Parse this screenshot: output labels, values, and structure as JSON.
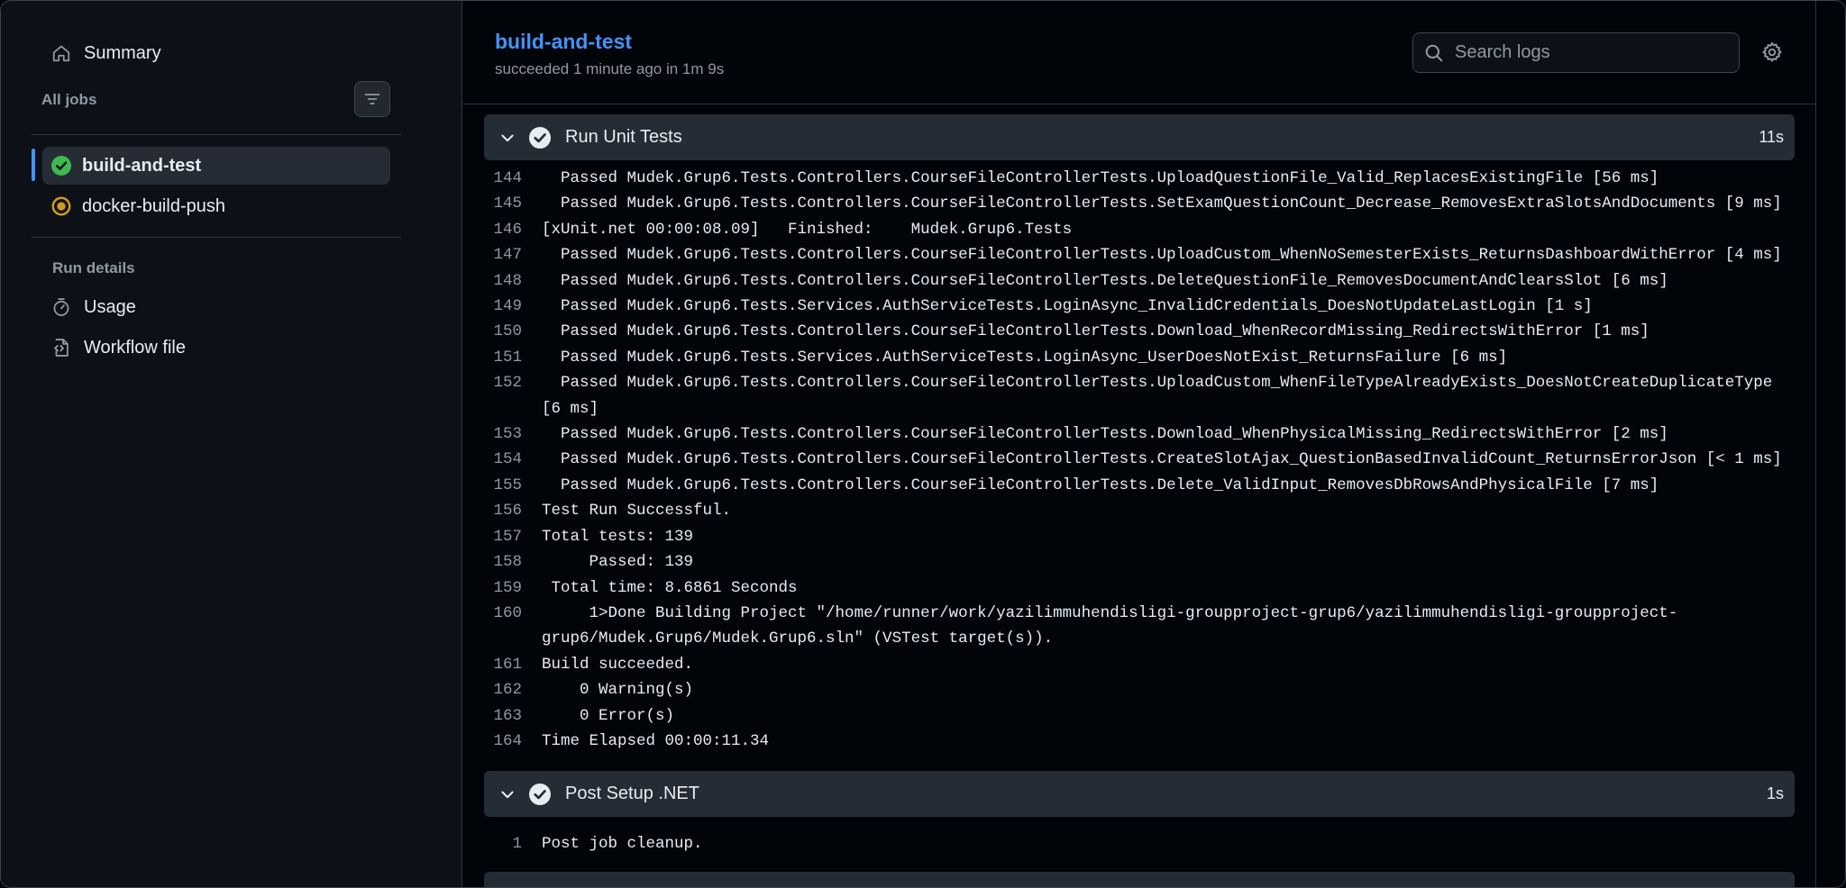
{
  "sidebar": {
    "summary_label": "Summary",
    "all_jobs_label": "All jobs",
    "jobs": [
      {
        "label": "build-and-test",
        "status": "success"
      },
      {
        "label": "docker-build-push",
        "status": "in-progress"
      }
    ],
    "run_details_label": "Run details",
    "usage_label": "Usage",
    "workflow_file_label": "Workflow file"
  },
  "header": {
    "title": "build-and-test",
    "subtitle": "succeeded 1 minute ago in 1m 9s",
    "search_placeholder": "Search logs"
  },
  "steps": [
    {
      "name": "Run Unit Tests",
      "duration": "11s",
      "lines": [
        {
          "n": "144",
          "t": "  Passed Mudek.Grup6.Tests.Controllers.CourseFileControllerTests.UploadQuestionFile_Valid_ReplacesExistingFile [56 ms]"
        },
        {
          "n": "145",
          "t": "  Passed Mudek.Grup6.Tests.Controllers.CourseFileControllerTests.SetExamQuestionCount_Decrease_RemovesExtraSlotsAndDocuments [9 ms]"
        },
        {
          "n": "146",
          "t": "[xUnit.net 00:00:08.09]   Finished:    Mudek.Grup6.Tests"
        },
        {
          "n": "147",
          "t": "  Passed Mudek.Grup6.Tests.Controllers.CourseFileControllerTests.UploadCustom_WhenNoSemesterExists_ReturnsDashboardWithError [4 ms]"
        },
        {
          "n": "148",
          "t": "  Passed Mudek.Grup6.Tests.Controllers.CourseFileControllerTests.DeleteQuestionFile_RemovesDocumentAndClearsSlot [6 ms]"
        },
        {
          "n": "149",
          "t": "  Passed Mudek.Grup6.Tests.Services.AuthServiceTests.LoginAsync_InvalidCredentials_DoesNotUpdateLastLogin [1 s]"
        },
        {
          "n": "150",
          "t": "  Passed Mudek.Grup6.Tests.Controllers.CourseFileControllerTests.Download_WhenRecordMissing_RedirectsWithError [1 ms]"
        },
        {
          "n": "151",
          "t": "  Passed Mudek.Grup6.Tests.Services.AuthServiceTests.LoginAsync_UserDoesNotExist_ReturnsFailure [6 ms]"
        },
        {
          "n": "152",
          "t": "  Passed Mudek.Grup6.Tests.Controllers.CourseFileControllerTests.UploadCustom_WhenFileTypeAlreadyExists_DoesNotCreateDuplicateType\n[6 ms]"
        },
        {
          "n": "153",
          "t": "  Passed Mudek.Grup6.Tests.Controllers.CourseFileControllerTests.Download_WhenPhysicalMissing_RedirectsWithError [2 ms]"
        },
        {
          "n": "154",
          "t": "  Passed Mudek.Grup6.Tests.Controllers.CourseFileControllerTests.CreateSlotAjax_QuestionBasedInvalidCount_ReturnsErrorJson [< 1 ms]"
        },
        {
          "n": "155",
          "t": "  Passed Mudek.Grup6.Tests.Controllers.CourseFileControllerTests.Delete_ValidInput_RemovesDbRowsAndPhysicalFile [7 ms]"
        },
        {
          "n": "156",
          "t": "Test Run Successful."
        },
        {
          "n": "157",
          "t": "Total tests: 139"
        },
        {
          "n": "158",
          "t": "     Passed: 139"
        },
        {
          "n": "159",
          "t": " Total time: 8.6861 Seconds"
        },
        {
          "n": "160",
          "t": "     1>Done Building Project \"/home/runner/work/yazilimmuhendisligi-groupproject-grup6/yazilimmuhendisligi-groupproject-\ngrup6/Mudek.Grup6/Mudek.Grup6.sln\" (VSTest target(s))."
        },
        {
          "n": "161",
          "t": "Build succeeded."
        },
        {
          "n": "162",
          "t": "    0 Warning(s)"
        },
        {
          "n": "163",
          "t": "    0 Error(s)"
        },
        {
          "n": "164",
          "t": "Time Elapsed 00:00:11.34"
        }
      ]
    },
    {
      "name": "Post Setup .NET",
      "duration": "1s",
      "lines": [
        {
          "n": "1",
          "t": "Post job cleanup."
        }
      ]
    }
  ],
  "colors": {
    "accent": "#4493f8",
    "success": "#3fb950",
    "in_progress": "#d29922"
  }
}
